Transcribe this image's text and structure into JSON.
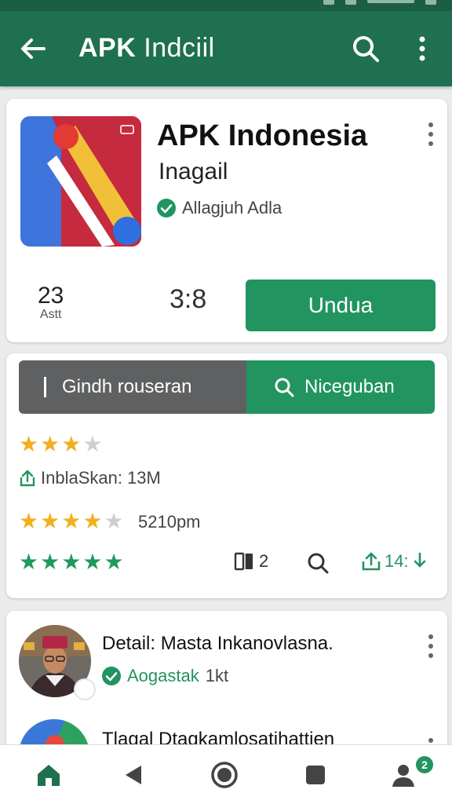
{
  "appbar": {
    "title_bold": "APK",
    "title_rest": "Indciil"
  },
  "app": {
    "name": "APK Indonesia",
    "subtitle": "Inagail",
    "developer": "Allagjuh Adla",
    "stat1_value": "23",
    "stat1_label": "Astt",
    "stat2_value": "3:8",
    "install_label": "Undua"
  },
  "search": {
    "text": "Gindh rouseran",
    "button_label": "Niceguban"
  },
  "ratings": {
    "row1_stars": 3,
    "info_text": "InblaSkan: 13M",
    "row2_stars": 4,
    "row2_text": "5210pm",
    "row3_stars": 5,
    "action_compare": "2",
    "action_share": "14:"
  },
  "review1": {
    "title": "Detail: Masta Inkanovlasna.",
    "verified_label": "Aogastak",
    "verified_extra": "1kt"
  },
  "review2": {
    "title": "Tlagal Dtagkamlosatihattien"
  },
  "nav": {
    "badge": "2"
  },
  "colors": {
    "primary": "#1e7050",
    "accent": "#229460",
    "star": "#f2b01e",
    "star_green": "#1e9a5c"
  }
}
